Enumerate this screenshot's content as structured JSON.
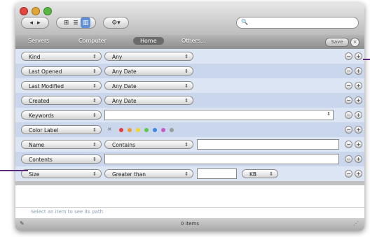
{
  "toolbar": {
    "back_label": "◂",
    "forward_label": "▸",
    "view_icon_label": "⊞",
    "view_list_label": "≣",
    "view_column_label": "▥",
    "action_label": "⚙▾"
  },
  "search": {
    "icon": "🔍",
    "value": ""
  },
  "scope": {
    "servers": "Servers",
    "computer": "Computer",
    "home": "Home",
    "others": "Others...",
    "save": "Save",
    "close": "×"
  },
  "rows": [
    {
      "attr": "Kind",
      "op": "Any"
    },
    {
      "attr": "Last Opened",
      "op": "Any Date"
    },
    {
      "attr": "Last Modified",
      "op": "Any Date"
    },
    {
      "attr": "Created",
      "op": "Any Date"
    },
    {
      "attr": "Keywords",
      "op": ""
    },
    {
      "attr": "Color Label",
      "op": ""
    },
    {
      "attr": "Name",
      "op": "Contains"
    },
    {
      "attr": "Contents",
      "op": ""
    },
    {
      "attr": "Size",
      "op": "Greater than",
      "unit": "KB"
    }
  ],
  "labels_colors": [
    "#e53b3b",
    "#f29a2e",
    "#f2d42e",
    "#5ec94a",
    "#3b87e0",
    "#c657c9",
    "#9b9b9b"
  ],
  "path_hint": "Select an item to see its path",
  "status": "0 items",
  "controls": {
    "minus": "−",
    "plus": "+",
    "arrow": "⇕"
  }
}
